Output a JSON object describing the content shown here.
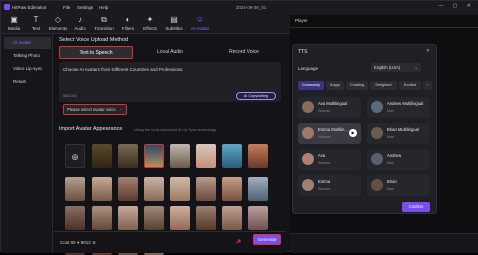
{
  "app": {
    "name": "HitPaw Edimakor",
    "menu": [
      "File",
      "Settings",
      "Help"
    ],
    "window_title": "2024-09-06_01"
  },
  "toolbar": [
    {
      "label": "Media",
      "icon": "media-icon"
    },
    {
      "label": "Text",
      "icon": "text-icon"
    },
    {
      "label": "Elements",
      "icon": "elements-icon"
    },
    {
      "label": "Audio",
      "icon": "audio-icon"
    },
    {
      "label": "Transition",
      "icon": "transition-icon"
    },
    {
      "label": "Filters",
      "icon": "filters-icon"
    },
    {
      "label": "Effects",
      "icon": "effects-icon"
    },
    {
      "label": "Subtitles",
      "icon": "subtitles-icon"
    },
    {
      "label": "AI Avatar",
      "icon": "ai-avatar-icon",
      "active": true
    }
  ],
  "sidebar": {
    "items": [
      "AI Avatar",
      "Talking Photo",
      "Video Lip-sync",
      "Result"
    ]
  },
  "voice_method": {
    "title": "Select Voice Upload Method",
    "tabs": [
      "Text to Speech",
      "Local Audio",
      "Record Voice"
    ],
    "text": "Choose AI Avatars from Different Countries and Professions",
    "count": "58/2000",
    "copywriting_label": "AI Copywriting",
    "voice_placeholder": "Please select avatar voice"
  },
  "import": {
    "title": "Import Avatar Appearance",
    "subtitle": "Using the most advanced AI Lip Sync technology"
  },
  "bottom": {
    "cost_label": "Cost",
    "cost_value": "90",
    "credits": "9012",
    "generate_label": "Generate"
  },
  "player": {
    "title": "Player"
  },
  "tts": {
    "title": "TTS",
    "language_label": "Language",
    "language_value": "English (USA)",
    "emotions": [
      "Commonly",
      "Angry",
      "Chatting",
      "Delighted",
      "Excited"
    ],
    "voices": [
      {
        "name": "Ava Multilingual",
        "gender": "Woman"
      },
      {
        "name": "Andrew Multilingual",
        "gender": "Man"
      },
      {
        "name": "Emma Multilin...",
        "gender": "Woman"
      },
      {
        "name": "Brian Multilingual",
        "gender": "Man"
      },
      {
        "name": "Ava",
        "gender": "Woman"
      },
      {
        "name": "Andrew",
        "gender": "Man"
      },
      {
        "name": "Emma",
        "gender": "Woman"
      },
      {
        "name": "Brian",
        "gender": "Man"
      }
    ],
    "confirm_label": "Confirm"
  },
  "colors": {
    "accent": "#7a4cf2",
    "highlight": "#e03030",
    "background": "#141418"
  }
}
